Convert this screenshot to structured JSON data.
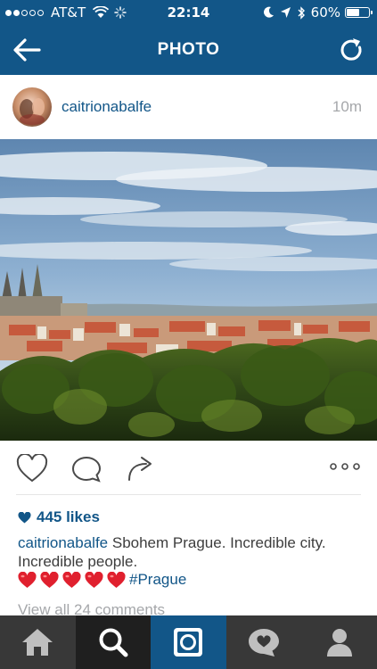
{
  "status_bar": {
    "carrier": "AT&T",
    "time": "22:14",
    "battery_percent": "60%",
    "battery_level": 0.6,
    "signal_bars_filled": 2,
    "signal_bars_total": 5
  },
  "nav": {
    "title": "PHOTO",
    "back_icon": "back-arrow-icon",
    "refresh_icon": "refresh-icon"
  },
  "post": {
    "username": "caitrionabalfe",
    "time_ago": "10m",
    "likes": "445 likes",
    "caption_user": "caitrionabalfe",
    "caption_text": "Sbohem Prague. Incredible city. Incredible people.",
    "caption_hearts": [
      "❤️",
      "❤️",
      "❤️",
      "❤️",
      "❤️"
    ],
    "hashtag": "#Prague",
    "view_comments": "View all 24 comments"
  },
  "actions": [
    "like-icon",
    "comment-icon",
    "share-icon",
    "more-icon"
  ],
  "tabbar": [
    "home-icon",
    "search-icon",
    "camera-icon",
    "activity-icon",
    "profile-icon"
  ],
  "colors": {
    "brand": "#125688",
    "tabbar": "#383838",
    "tab_active": "#1f1f1f",
    "muted": "#a5a7aa"
  }
}
